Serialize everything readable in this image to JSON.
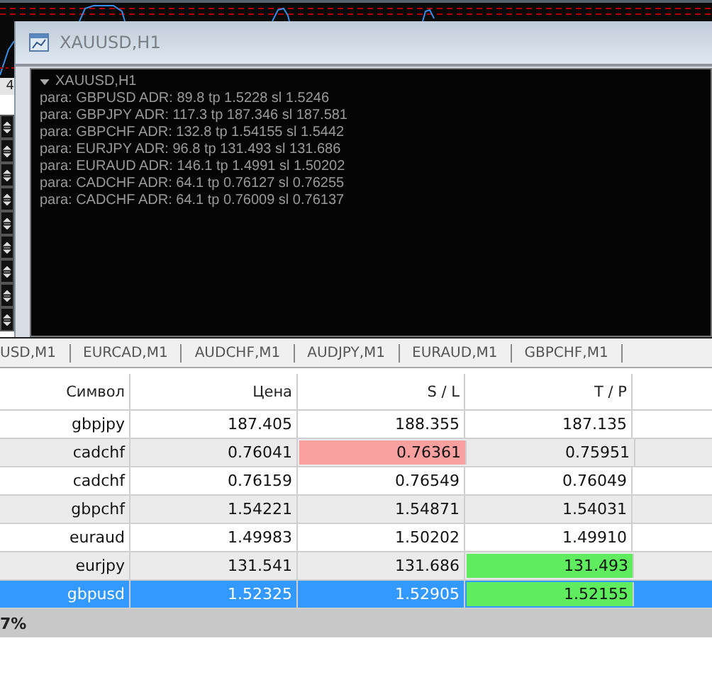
{
  "side_label": "4",
  "window": {
    "title": "XAUUSD,H1"
  },
  "log": {
    "header": "XAUUSD,H1",
    "expanded": true,
    "lines": [
      "para: GBPUSD ADR: 89.8 tp 1.5228 sl 1.5246",
      "para: GBPJPY ADR: 117.3 tp 187.346 sl 187.581",
      "para: GBPCHF ADR: 132.8 tp 1.54155 sl 1.5442",
      "para: EURJPY ADR: 96.8 tp 131.493 sl 131.686",
      "para: EURAUD ADR: 146.1 tp 1.4991 sl 1.50202",
      "para: CADCHF ADR: 64.1 tp 0.76127 sl 0.76255",
      "para: CADCHF ADR: 64.1 tp 0.76009 sl 0.76137"
    ]
  },
  "chart_tabs": [
    "USD,M1",
    "EURCAD,M1",
    "AUDCHF,M1",
    "AUDJPY,M1",
    "EURAUD,M1",
    "GBPCHF,M1"
  ],
  "table": {
    "columns": [
      "Символ",
      "Цена",
      "S / L",
      "T / P"
    ],
    "rows": [
      {
        "symbol": "gbpjpy",
        "price": "187.405",
        "sl": "188.355",
        "tp": "187.135",
        "sl_alert": false,
        "tp_alert": false,
        "selected": false
      },
      {
        "symbol": "cadchf",
        "price": "0.76041",
        "sl": "0.76361",
        "tp": "0.75951",
        "sl_alert": true,
        "tp_alert": false,
        "selected": false
      },
      {
        "symbol": "cadchf",
        "price": "0.76159",
        "sl": "0.76549",
        "tp": "0.76049",
        "sl_alert": false,
        "tp_alert": false,
        "selected": false
      },
      {
        "symbol": "gbpchf",
        "price": "1.54221",
        "sl": "1.54871",
        "tp": "1.54031",
        "sl_alert": false,
        "tp_alert": false,
        "selected": false
      },
      {
        "symbol": "euraud",
        "price": "1.49983",
        "sl": "1.50202",
        "tp": "1.49910",
        "sl_alert": false,
        "tp_alert": false,
        "selected": false
      },
      {
        "symbol": "eurjpy",
        "price": "131.541",
        "sl": "131.686",
        "tp": "131.493",
        "sl_alert": false,
        "tp_alert": true,
        "selected": false
      },
      {
        "symbol": "gbpusd",
        "price": "1.52325",
        "sl": "1.52905",
        "tp": "1.52155",
        "sl_alert": false,
        "tp_alert": true,
        "selected": true
      }
    ]
  },
  "status_bar": {
    "text": "7%"
  }
}
